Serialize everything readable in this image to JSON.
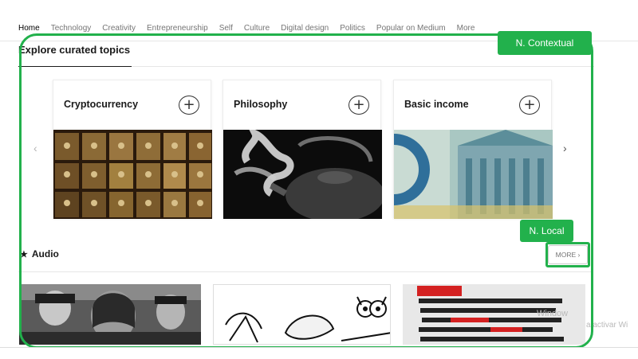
{
  "nav": {
    "items": [
      "Home",
      "Technology",
      "Creativity",
      "Entrepreneurship",
      "Self",
      "Culture",
      "Digital design",
      "Politics",
      "Popular on Medium",
      "More"
    ],
    "active": "Home"
  },
  "explore": {
    "title": "Explore curated topics",
    "cards": [
      {
        "title": "Cryptocurrency",
        "follow_icon": "plus-icon"
      },
      {
        "title": "Philosophy",
        "follow_icon": "plus-icon"
      },
      {
        "title": "Basic income",
        "follow_icon": "plus-icon"
      }
    ],
    "prev_icon": "chevron-left-icon",
    "next_icon": "chevron-right-icon"
  },
  "audio": {
    "star": "★",
    "title": "Audio",
    "more_label": "MORE",
    "more_chevron": "›"
  },
  "annotations": {
    "contextual_label": "N. Contextual",
    "local_label": "N. Local",
    "color": "#22b14c"
  },
  "watermark": {
    "line1": "Window",
    "line2": "a activar Wi"
  }
}
